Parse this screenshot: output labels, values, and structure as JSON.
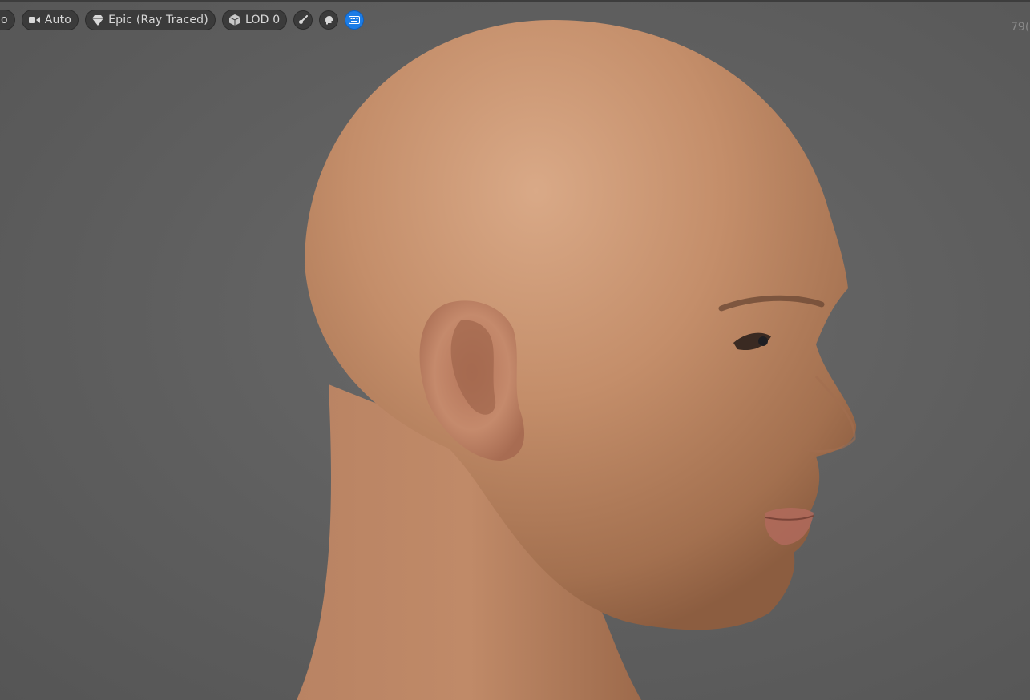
{
  "toolbar": {
    "clipped_label": "o",
    "camera": {
      "icon": "video-camera-icon",
      "label": "Auto"
    },
    "quality": {
      "icon": "diamond-icon",
      "label": "Epic (Ray Traced)"
    },
    "lod": {
      "icon": "cube-icon",
      "label": "LOD 0"
    },
    "tools": [
      {
        "icon": "brush-icon"
      },
      {
        "icon": "head-profile-icon"
      },
      {
        "icon": "keyboard-icon",
        "active": true
      }
    ]
  },
  "viewport": {
    "readout": "79("
  },
  "colors": {
    "background": "#5f5f5f",
    "pill": "#3b3b3b",
    "active": "#1b7ce6",
    "skin": "#c48e6a"
  }
}
